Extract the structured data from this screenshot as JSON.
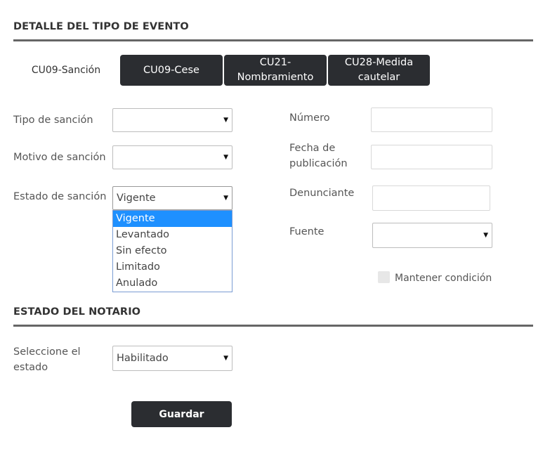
{
  "detalle": {
    "title": "DETALLE DEL TIPO DE EVENTO",
    "tab_active": "CU09-Sanción",
    "tabs": [
      "CU09-Cese",
      "CU21-\nNombramiento",
      "CU28-Medida\ncautelar"
    ]
  },
  "form": {
    "tipo_sancion_label": "Tipo de sanción",
    "motivo_sancion_label": "Motivo de sanción",
    "estado_sancion_label": "Estado de sanción",
    "estado_sancion_value": "Vigente",
    "estado_options": [
      "Vigente",
      "Levantado",
      "Sin efecto",
      "Limitado",
      "Anulado"
    ],
    "numero_label": "Número",
    "fecha_label": "Fecha de\npublicación",
    "denunciante_label": "Denunciante",
    "fuente_label": "Fuente",
    "mantener_label": "Mantener condición"
  },
  "notario": {
    "title": "ESTADO DEL NOTARIO",
    "seleccione_label": "Seleccione el\nestado",
    "estado_value": "Habilitado",
    "save_label": "Guardar"
  },
  "icons": {
    "dropdown_arrow": "▼"
  }
}
